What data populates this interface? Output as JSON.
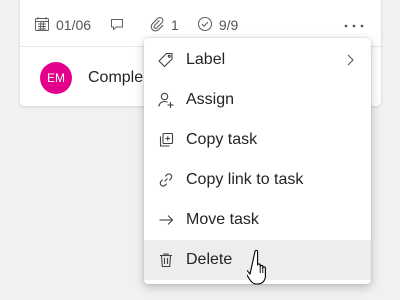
{
  "card": {
    "due_date": "01/06",
    "attachment_count": "1",
    "checklist_progress": "9/9",
    "assignee_initials": "EM",
    "title": "Comple",
    "avatar_color": "#e3008c"
  },
  "menu": {
    "items": [
      {
        "label": "Label",
        "icon": "tag-icon",
        "has_submenu": true
      },
      {
        "label": "Assign",
        "icon": "person-add-icon"
      },
      {
        "label": "Copy task",
        "icon": "copy-icon"
      },
      {
        "label": "Copy link to task",
        "icon": "link-icon"
      },
      {
        "label": "Move task",
        "icon": "arrow-right-icon"
      },
      {
        "label": "Delete",
        "icon": "trash-icon",
        "hovered": true
      }
    ]
  }
}
